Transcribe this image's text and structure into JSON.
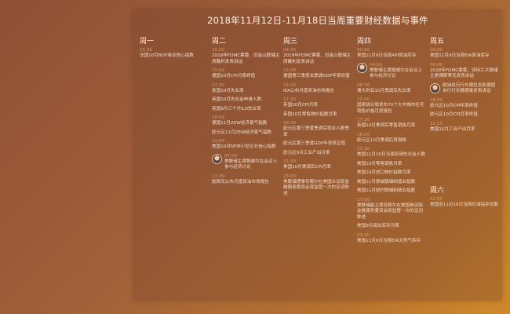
{
  "title": "2018年11月12日-11月18日当周重要财经数据与事件",
  "columns": [
    {
      "day": "周一",
      "events": [
        {
          "time": "15:30",
          "text": "法国10月BOF商业信心指数"
        }
      ]
    },
    {
      "day": "周二",
      "events": [
        {
          "time": "20:30",
          "text": "2018年FOMC票委、旧金山联储主席戴利发表讲话"
        },
        {
          "time": "15:00",
          "text": "德国10月CPI月率终值"
        },
        {
          "time": "17:30",
          "text": "英国10月失业率"
        },
        {
          "time": "",
          "text": "英国10月失业金申请人数"
        },
        {
          "time": "",
          "text": "英国9月三个月ILO失业率"
        },
        {
          "time": "18:00",
          "text": "德国11月ZEW经济景气指数"
        },
        {
          "time": "",
          "text": "欧元区11月ZEW经济景气指数"
        },
        {
          "time": "19:00",
          "text": "美国10月NFIB小型企业信心指数"
        },
        {
          "time": "07:00",
          "text": "美联储主席鲍威尔在会议上参与经济讨论",
          "avatar": true
        },
        {
          "time": "13:30",
          "text": "欧佩克公布月度原油市场报告"
        }
      ]
    },
    {
      "day": "周三",
      "events": [
        {
          "time": "04:30",
          "text": "2018年FOMC票委、旧金山联储主席戴利发表讲话"
        },
        {
          "time": "15:00",
          "text": "德国第三季度未季调GDP年率初值"
        },
        {
          "time": "16:00",
          "text": "IEA公布月度原油市场报告"
        },
        {
          "time": "17:30",
          "text": "英国10月CPI月率"
        },
        {
          "time": "",
          "text": "英国10月零售物价指数月率"
        },
        {
          "time": "18:00",
          "text": "欧元区第三季度季调后就业人数季率"
        },
        {
          "time": "",
          "text": "欧元区第三季度GDP年率修正值"
        },
        {
          "time": "",
          "text": "欧元区9月工业产出月率"
        },
        {
          "time": "21:30",
          "text": "美国10月季调后CPI月率"
        },
        {
          "time": "23:00",
          "text": "美联储理事夸赖尔在美国众议院金融服务委员会就监管一次的证词陈述"
        }
      ]
    },
    {
      "day": "周四",
      "events": [
        {
          "time": "00:00",
          "text": "美国11月9日当周API原油库存"
        },
        {
          "time": "04:00",
          "text": "美联储主席鲍威尔在会议上参与经济讨论",
          "avatar": true
        },
        {
          "time": "08:30",
          "text": "澳大利亚10月季调后失业率"
        },
        {
          "time": "10:00",
          "text": "国家统计局发布70个大中城市住宅销售价格月度报告"
        },
        {
          "time": "17:30",
          "text": "英国10月季调后零售销售月率"
        },
        {
          "time": "18:00",
          "text": "欧元区10月季调后贸易帐"
        },
        {
          "time": "21:30",
          "text": "美国11月10日当周初请失业金人数"
        },
        {
          "time": "",
          "text": "美国10月零售销售月率"
        },
        {
          "time": "",
          "text": "美国10月进口物价指数月率"
        },
        {
          "time": "",
          "text": "美国11月费城联储制造业指数"
        },
        {
          "time": "",
          "text": "美国11月纽约联储制造业指数"
        },
        {
          "time": "23:00",
          "text": "美联储副主席夸赖尔在美国参议院金融服务委员会就监管一次的证词陈述"
        },
        {
          "time": "",
          "text": "美国9月商业库存月率"
        },
        {
          "time": "23:30",
          "text": "美国11月9日当周EIA天然气库存"
        }
      ]
    },
    {
      "day": "周五",
      "events": [
        {
          "time": "00:00",
          "text": "美国11月9日当周EIA原油库存"
        },
        {
          "time": "00:00",
          "text": "2018年FOMC票委、亚特兰大联储主席博斯蒂克发表讲话"
        },
        {
          "time": "",
          "text": "欧洲央行行长德拉吉和德国央行行长魏德曼发表讲话",
          "avatar": true
        },
        {
          "time": "18:00",
          "text": "欧元区10月CPI年率终值"
        },
        {
          "time": "",
          "text": "欧元区10月CPI月率终值"
        },
        {
          "time": "22:15",
          "text": "美国10月工业产出月率"
        }
      ]
    },
    {
      "day": "周六",
      "events": [
        {
          "time": "02:00",
          "text": "美国至11月16日当周石油钻井总数"
        }
      ]
    }
  ]
}
